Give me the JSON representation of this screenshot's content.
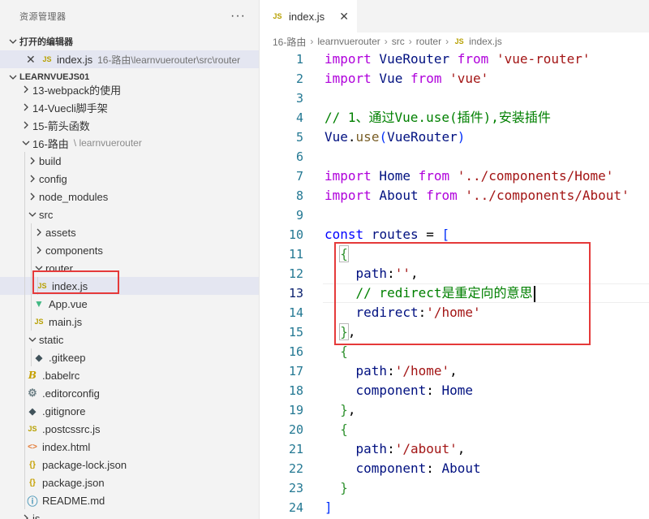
{
  "explorer": {
    "title": "资源管理器",
    "more": "···",
    "open_editors_label": "打开的编辑器",
    "open_editor": {
      "close": "✕",
      "icon": "JS",
      "name": "index.js",
      "path": "16-路由\\learnvuerouter\\src\\router"
    },
    "workspace_label": "LEARNVUEJS01",
    "tree": [
      {
        "label": "13-webpack的使用",
        "type": "folder",
        "depth": 1,
        "expanded": false
      },
      {
        "label": "14-Vuecli脚手架",
        "type": "folder",
        "depth": 1,
        "expanded": false
      },
      {
        "label": "15-箭头函数",
        "type": "folder",
        "depth": 1,
        "expanded": false
      },
      {
        "label": "16-路由",
        "extra": "learnvuerouter",
        "type": "folder",
        "depth": 1,
        "expanded": true
      },
      {
        "label": "build",
        "type": "folder",
        "depth": 2,
        "expanded": false
      },
      {
        "label": "config",
        "type": "folder",
        "depth": 2,
        "expanded": false
      },
      {
        "label": "node_modules",
        "type": "folder",
        "depth": 2,
        "expanded": false
      },
      {
        "label": "src",
        "type": "folder",
        "depth": 2,
        "expanded": true
      },
      {
        "label": "assets",
        "type": "folder",
        "depth": 3,
        "expanded": false
      },
      {
        "label": "components",
        "type": "folder",
        "depth": 3,
        "expanded": false
      },
      {
        "label": "router",
        "type": "folder",
        "depth": 3,
        "expanded": true
      },
      {
        "label": "index.js",
        "type": "js",
        "depth": 4,
        "selected": true
      },
      {
        "label": "App.vue",
        "type": "vue",
        "depth": 3
      },
      {
        "label": "main.js",
        "type": "js",
        "depth": 3
      },
      {
        "label": "static",
        "type": "folder",
        "depth": 2,
        "expanded": true
      },
      {
        "label": ".gitkeep",
        "type": "git",
        "depth": 3
      },
      {
        "label": ".babelrc",
        "type": "babel",
        "depth": 2
      },
      {
        "label": ".editorconfig",
        "type": "gear",
        "depth": 2
      },
      {
        "label": ".gitignore",
        "type": "git",
        "depth": 2
      },
      {
        "label": ".postcssrc.js",
        "type": "js",
        "depth": 2
      },
      {
        "label": "index.html",
        "type": "html",
        "depth": 2
      },
      {
        "label": "package-lock.json",
        "type": "json",
        "depth": 2
      },
      {
        "label": "package.json",
        "type": "json",
        "depth": 2
      },
      {
        "label": "README.md",
        "type": "info",
        "depth": 2
      },
      {
        "label": "js",
        "type": "folder",
        "depth": 1,
        "expanded": false
      }
    ]
  },
  "editor": {
    "tab": {
      "icon": "JS",
      "name": "index.js",
      "close": "✕"
    },
    "breadcrumb": [
      "16-路由",
      "learnvuerouter",
      "src",
      "router"
    ],
    "breadcrumb_file": "index.js",
    "current_line": 13,
    "lines": [
      [
        [
          "import",
          "kw2"
        ],
        [
          " VueRouter ",
          "id"
        ],
        [
          "from",
          "kw2"
        ],
        [
          " ",
          ""
        ],
        [
          "'vue-router'",
          "str"
        ]
      ],
      [
        [
          "import",
          "kw2"
        ],
        [
          " Vue ",
          "id"
        ],
        [
          "from",
          "kw2"
        ],
        [
          " ",
          ""
        ],
        [
          "'vue'",
          "str"
        ]
      ],
      [],
      [
        [
          "// 1、通过Vue.use(插件),安装插件",
          "com"
        ]
      ],
      [
        [
          "Vue",
          "id"
        ],
        [
          ".",
          ""
        ],
        [
          "use",
          "fn"
        ],
        [
          "(",
          "br1"
        ],
        [
          "VueRouter",
          "id"
        ],
        [
          ")",
          "br1"
        ]
      ],
      [],
      [
        [
          "import",
          "kw2"
        ],
        [
          " Home ",
          "id"
        ],
        [
          "from",
          "kw2"
        ],
        [
          " ",
          ""
        ],
        [
          "'../components/Home'",
          "str"
        ]
      ],
      [
        [
          "import",
          "kw2"
        ],
        [
          " About ",
          "id"
        ],
        [
          "from",
          "kw2"
        ],
        [
          " ",
          ""
        ],
        [
          "'../components/About'",
          "str"
        ]
      ],
      [],
      [
        [
          "const",
          "kw"
        ],
        [
          " ",
          ""
        ],
        [
          "routes",
          "id"
        ],
        [
          " = ",
          ""
        ],
        [
          "[",
          "br1"
        ]
      ],
      [
        [
          "  ",
          ""
        ],
        [
          "{",
          "br2 brbox"
        ]
      ],
      [
        [
          "    ",
          ""
        ],
        [
          "path",
          "id"
        ],
        [
          ":",
          ""
        ],
        [
          "''",
          "str"
        ],
        [
          ",",
          ""
        ]
      ],
      [
        [
          "    ",
          ""
        ],
        [
          "// redirect是重定向的意思",
          "com"
        ]
      ],
      [
        [
          "    ",
          ""
        ],
        [
          "redirect",
          "id"
        ],
        [
          ":",
          ""
        ],
        [
          "'/home'",
          "str"
        ]
      ],
      [
        [
          "  ",
          ""
        ],
        [
          "}",
          "br2 brbox"
        ],
        [
          ",",
          ""
        ]
      ],
      [
        [
          "  ",
          ""
        ],
        [
          "{",
          "br2"
        ]
      ],
      [
        [
          "    ",
          ""
        ],
        [
          "path",
          "id"
        ],
        [
          ":",
          ""
        ],
        [
          "'/home'",
          "str"
        ],
        [
          ",",
          ""
        ]
      ],
      [
        [
          "    ",
          ""
        ],
        [
          "component",
          "id"
        ],
        [
          ": ",
          ""
        ],
        [
          "Home",
          "id"
        ]
      ],
      [
        [
          "  ",
          ""
        ],
        [
          "}",
          "br2"
        ],
        [
          ",",
          ""
        ]
      ],
      [
        [
          "  ",
          ""
        ],
        [
          "{",
          "br2"
        ]
      ],
      [
        [
          "    ",
          ""
        ],
        [
          "path",
          "id"
        ],
        [
          ":",
          ""
        ],
        [
          "'/about'",
          "str"
        ],
        [
          ",",
          ""
        ]
      ],
      [
        [
          "    ",
          ""
        ],
        [
          "component",
          "id"
        ],
        [
          ": ",
          ""
        ],
        [
          "About",
          "id"
        ]
      ],
      [
        [
          "  ",
          ""
        ],
        [
          "}",
          "br2"
        ]
      ],
      [
        [
          "]",
          "br1"
        ]
      ]
    ]
  },
  "colors": {
    "highlight_box": "#e53a3a",
    "selection_bg": "#e4e6f1"
  }
}
